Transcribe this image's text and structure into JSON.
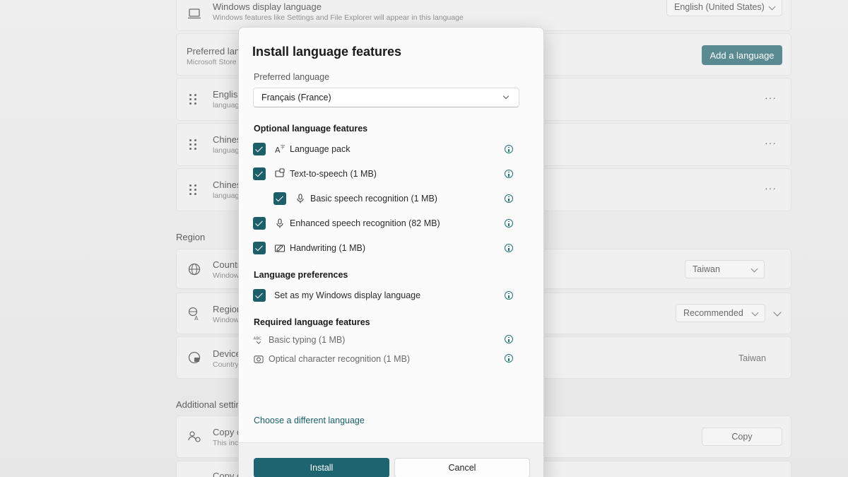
{
  "background": {
    "display_language": {
      "title": "Windows display language",
      "subtitle": "Windows features like Settings and File Explorer will appear in this language",
      "value": "English (United States)"
    },
    "preferred": {
      "title": "Preferred lang",
      "subtitle": "Microsoft Store",
      "button": "Add a language"
    },
    "languages": [
      {
        "title": "English",
        "subtitle": "languag"
      },
      {
        "title": "Chines",
        "subtitle": "languag"
      },
      {
        "title": "Chines",
        "subtitle": "languag"
      }
    ],
    "more_label": "···",
    "region_header": "Region",
    "country": {
      "title": "Countr",
      "subtitle": "Window",
      "value": "Taiwan"
    },
    "regional_format": {
      "title": "Region",
      "subtitle": "Window",
      "value": "Recommended"
    },
    "device": {
      "title": "Device",
      "subtitle": "Country",
      "value": "Taiwan"
    },
    "additional_header": "Additional settin",
    "copy": {
      "title": "Copy c",
      "subtitle": "This inc",
      "button": "Copy"
    },
    "copy2": {
      "title": "Copy c"
    }
  },
  "dialog": {
    "title": "Install language features",
    "preferred_label": "Preferred language",
    "preferred_value": "Français (France)",
    "optional_header": "Optional language features",
    "optional": [
      {
        "label": "Language pack",
        "icon": "language-pack-icon",
        "checked": true
      },
      {
        "label": "Text-to-speech (1 MB)",
        "icon": "text-to-speech-icon",
        "checked": true
      },
      {
        "label": "Basic speech recognition (1 MB)",
        "icon": "microphone-icon",
        "checked": true
      },
      {
        "label": "Enhanced speech recognition (82 MB)",
        "icon": "microphone-icon",
        "checked": true
      },
      {
        "label": "Handwriting (1 MB)",
        "icon": "handwriting-icon",
        "checked": true
      }
    ],
    "prefs_header": "Language preferences",
    "display_lang_checkbox": "Set as my Windows display language",
    "required_header": "Required language features",
    "required": [
      {
        "label": "Basic typing (1 MB)",
        "icon": "abc-typing-icon"
      },
      {
        "label": "Optical character recognition (1 MB)",
        "icon": "camera-ocr-icon"
      }
    ],
    "choose_link": "Choose a different language",
    "install_button": "Install",
    "cancel_button": "Cancel"
  },
  "colors": {
    "accent": "#1d5f69"
  }
}
